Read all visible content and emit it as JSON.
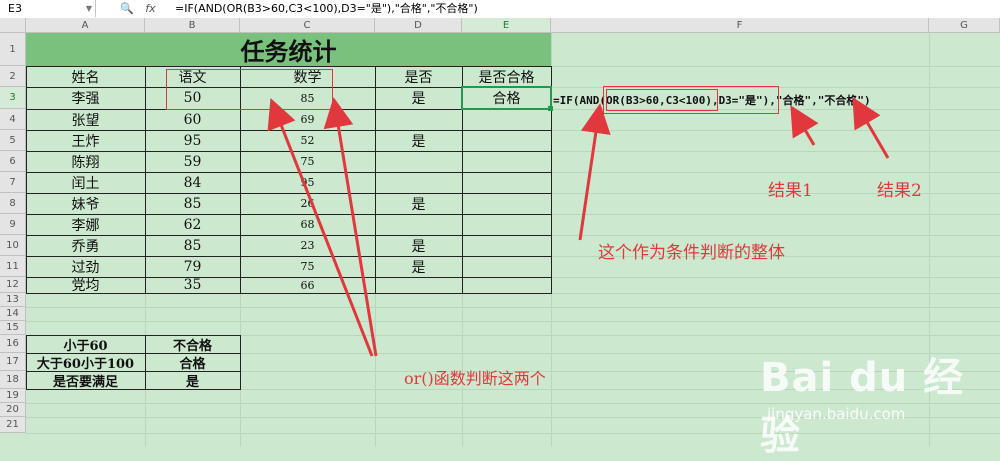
{
  "formula_bar": {
    "cell_ref": "E3",
    "fx": "fx",
    "formula": "=IF(AND(OR(B3>60,C3<100),D3=\"是\"),\"合格\",\"不合格\")"
  },
  "columns": [
    "A",
    "B",
    "C",
    "D",
    "E",
    "F",
    "G"
  ],
  "rows": [
    "1",
    "2",
    "3",
    "4",
    "5",
    "6",
    "7",
    "8",
    "9",
    "10",
    "11",
    "12",
    "13",
    "14",
    "15",
    "16",
    "17",
    "18",
    "19",
    "20",
    "21"
  ],
  "sheet": {
    "title": "任务统计",
    "headers": [
      "姓名",
      "语文",
      "数学",
      "是否",
      "是否合格"
    ],
    "records": [
      {
        "name": "李强",
        "chinese": "50",
        "math": "85",
        "flag": "是",
        "result": "合格"
      },
      {
        "name": "张望",
        "chinese": "60",
        "math": "69",
        "flag": "",
        "result": ""
      },
      {
        "name": "王炸",
        "chinese": "95",
        "math": "52",
        "flag": "是",
        "result": ""
      },
      {
        "name": "陈翔",
        "chinese": "59",
        "math": "75",
        "flag": "",
        "result": ""
      },
      {
        "name": "闰土",
        "chinese": "84",
        "math": "95",
        "flag": "",
        "result": ""
      },
      {
        "name": "妹爷",
        "chinese": "85",
        "math": "26",
        "flag": "是",
        "result": ""
      },
      {
        "name": "李娜",
        "chinese": "62",
        "math": "68",
        "flag": "",
        "result": ""
      },
      {
        "name": "乔勇",
        "chinese": "85",
        "math": "23",
        "flag": "是",
        "result": ""
      },
      {
        "name": "过劲",
        "chinese": "79",
        "math": "75",
        "flag": "是",
        "result": ""
      },
      {
        "name": "党均",
        "chinese": "35",
        "math": "66",
        "flag": "",
        "result": ""
      }
    ],
    "legend": [
      {
        "label": "小于60",
        "value": "不合格"
      },
      {
        "label": "大于60小于100",
        "value": "合格"
      },
      {
        "label": "是否要满足",
        "value": "是"
      }
    ]
  },
  "annotations": {
    "formula_display": "=IF(AND(OR(B3>60,C3<100),D3=\"是\"),\"合格\",\"不合格\")",
    "result1": "结果1",
    "result2": "结果2",
    "condition_whole": "这个作为条件判断的整体",
    "or_note": "or()函数判断这两个",
    "color": "#e0383c"
  },
  "watermark": {
    "logo": "Bai du 经验",
    "url": "jingyan.baidu.com"
  }
}
